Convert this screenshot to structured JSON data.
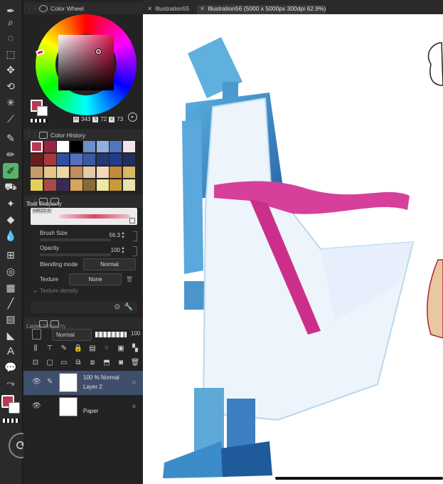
{
  "colors": {
    "main": "#b83a55",
    "sub": "#ffffff",
    "accent_tool": "#57b36a",
    "selection": "#3f4f6b"
  },
  "toolbar": {
    "tools": [
      "pen-tool-icon",
      "zoom-icon",
      "lasso-icon",
      "selection-icon",
      "move-icon",
      "rotate-icon",
      "magic-wand-icon",
      "eyedropper-icon",
      "pen-icon",
      "pencil-icon",
      "brush-icon",
      "airbrush-icon",
      "decoration-icon",
      "eraser-icon",
      "blend-icon",
      "frame-icon",
      "ruler-icon",
      "fill-icon",
      "gradient-icon",
      "line-icon",
      "panel-icon",
      "figure-icon",
      "text-icon",
      "balloon-icon",
      "correct-line-icon"
    ],
    "active_index": 10
  },
  "color_wheel": {
    "title": "Color Wheel",
    "h_label": "H",
    "s_label": "S",
    "v_label": "V",
    "h": "343",
    "s": "72",
    "v": "73"
  },
  "color_history": {
    "title": "Color History",
    "swatches": [
      "#b83a55",
      "#9c2440",
      "#ffffff",
      "#000000",
      "#6a8fc9",
      "#8fb0e0",
      "#4f77c0",
      "#f2e3ea",
      "#6b1d1d",
      "#a53a3a",
      "#2f4fa6",
      "#5570c0",
      "#3a5aa0",
      "#233a70",
      "#1f3d8a",
      "#223060",
      "#c69a68",
      "#e6c48a",
      "#e9d7a6",
      "#c78a5a",
      "#e3c9a8",
      "#f0d8b8",
      "#c48a3a",
      "#d8b860",
      "#e3d05a",
      "#a84a4a",
      "#3a2a5a",
      "#d8a45a",
      "#8a6a3a",
      "#f0e8a0",
      "#c89a3a",
      "#e8e2b0"
    ]
  },
  "tool_property": {
    "tabs": [
      "Sub Tool",
      "Tool Property"
    ],
    "brush_name": "HR23 It",
    "brush_size_label": "Brush Size",
    "brush_size": "56.3",
    "opacity_label": "Opacity",
    "opacity": "100",
    "blending_label": "Blending mode",
    "blending": "Normal",
    "texture_label": "Texture",
    "texture": "None",
    "texture_density_label": "Texture density"
  },
  "layer_panel": {
    "tabs": [
      "Layer",
      "Layer Property"
    ],
    "mode": "Normal",
    "opacity": "100",
    "layers": [
      {
        "line1": "100 %  Normal",
        "line2": "Layer 2",
        "selected": true
      },
      {
        "line1": "",
        "line2": "Paper",
        "selected": false
      }
    ]
  },
  "tabs": [
    {
      "label": "Illustration55",
      "active": false
    },
    {
      "label": "Illustration56 (5000 x 5000px 300dpi 62.9%)",
      "active": true
    }
  ]
}
